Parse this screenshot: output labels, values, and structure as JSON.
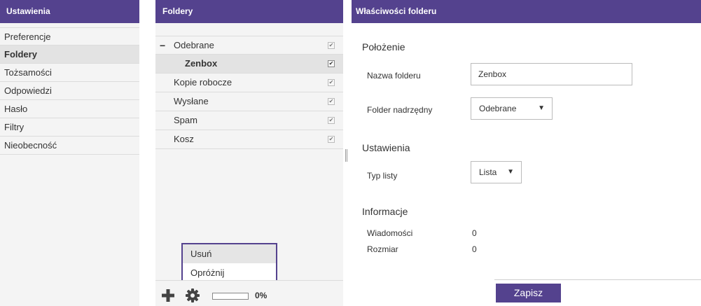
{
  "settings": {
    "title": "Ustawienia",
    "items": [
      {
        "label": "Preferencje"
      },
      {
        "label": "Foldery"
      },
      {
        "label": "Tożsamości"
      },
      {
        "label": "Odpowiedzi"
      },
      {
        "label": "Hasło"
      },
      {
        "label": "Filtry"
      },
      {
        "label": "Nieobecność"
      }
    ],
    "active_index": 1
  },
  "folders": {
    "title": "Foldery",
    "items": [
      {
        "label": "Odebrane",
        "expanded": true,
        "subscribed": true
      },
      {
        "label": "Zenbox",
        "subscribed": true,
        "selected": true
      },
      {
        "label": "Kopie robocze",
        "subscribed": true
      },
      {
        "label": "Wysłane",
        "subscribed": true
      },
      {
        "label": "Spam",
        "subscribed": true
      },
      {
        "label": "Kosz",
        "subscribed": true
      }
    ],
    "collapse_glyph": "−",
    "check_glyph": "✔",
    "context_menu": [
      {
        "label": "Usuń",
        "highlighted": true
      },
      {
        "label": "Opróżnij"
      }
    ],
    "quota_percent": 0,
    "quota_label": "0%"
  },
  "props": {
    "title": "Właściwości folderu",
    "location_title": "Położenie",
    "name_label": "Nazwa folderu",
    "name_value": "Zenbox",
    "parent_label": "Folder nadrzędny",
    "parent_value": "Odebrane",
    "settings_title": "Ustawienia",
    "list_type_label": "Typ listy",
    "list_type_value": "Lista",
    "info_title": "Informacje",
    "messages_label": "Wiadomości",
    "messages_value": "0",
    "size_label": "Rozmiar",
    "size_value": "0",
    "caret_glyph": "▼",
    "save_label": "Zapisz"
  },
  "colors": {
    "accent": "#54428e",
    "panel_bg": "#f4f4f4",
    "selected_bg": "#e3e3e3"
  }
}
